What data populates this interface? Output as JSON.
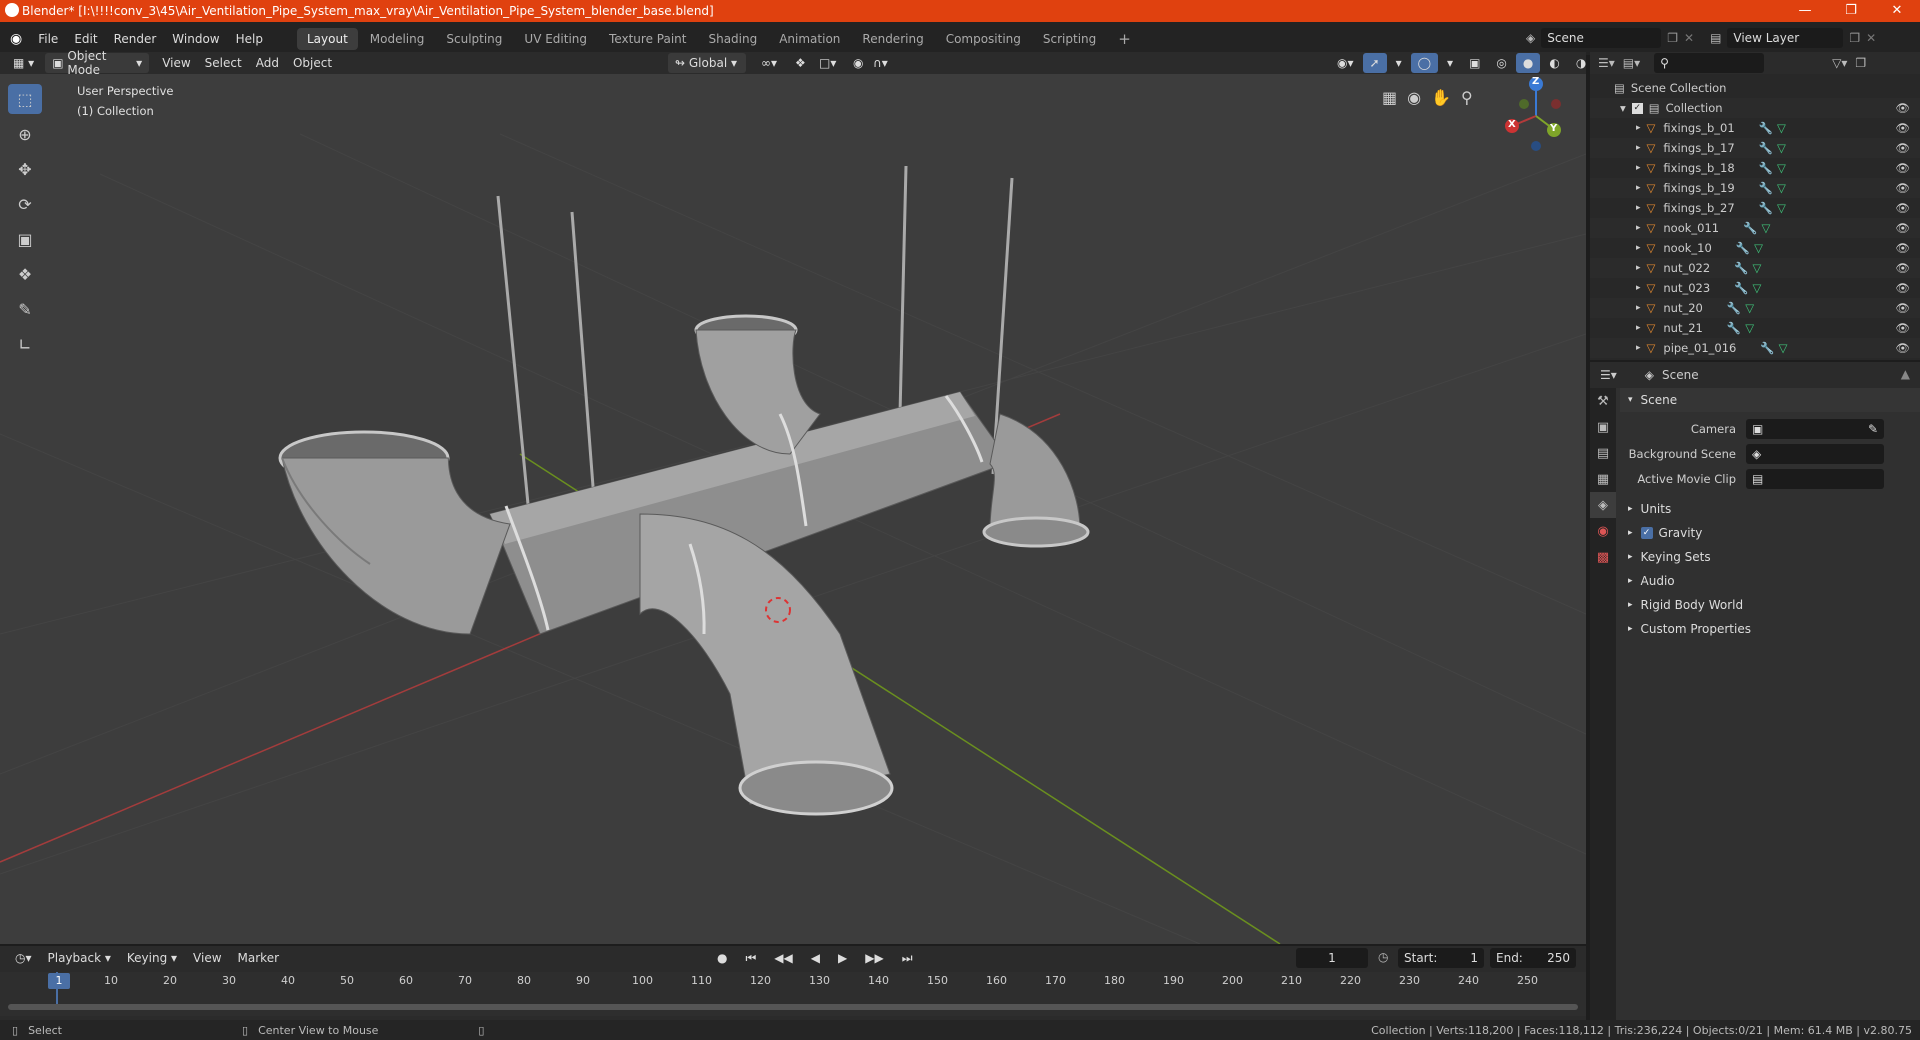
{
  "window": {
    "title": "Blender* [I:\\!!!!conv_3\\45\\Air_Ventilation_Pipe_System_max_vray\\Air_Ventilation_Pipe_System_blender_base.blend]"
  },
  "menu": {
    "items": [
      "File",
      "Edit",
      "Render",
      "Window",
      "Help"
    ],
    "workspaces": [
      "Layout",
      "Modeling",
      "Sculpting",
      "UV Editing",
      "Texture Paint",
      "Shading",
      "Animation",
      "Rendering",
      "Compositing",
      "Scripting"
    ],
    "active_workspace": "Layout",
    "scene": "Scene",
    "view_layer": "View Layer"
  },
  "viewport_header": {
    "mode": "Object Mode",
    "menus": [
      "View",
      "Select",
      "Add",
      "Object"
    ],
    "orientation": "Global"
  },
  "viewport": {
    "perspective": "User Perspective",
    "collection": "(1) Collection",
    "gizmo": {
      "x": "X",
      "y": "Y",
      "z": "Z"
    }
  },
  "outliner": {
    "root": "Scene Collection",
    "collection": "Collection",
    "items": [
      "fixings_b_01",
      "fixings_b_17",
      "fixings_b_18",
      "fixings_b_19",
      "fixings_b_27",
      "nook_011",
      "nook_10",
      "nut_022",
      "nut_023",
      "nut_20",
      "nut_21",
      "pipe_01_016"
    ]
  },
  "properties": {
    "context": "Scene",
    "section": "Scene",
    "fields": [
      {
        "label": "Camera",
        "value": ""
      },
      {
        "label": "Background Scene",
        "value": ""
      },
      {
        "label": "Active Movie Clip",
        "value": ""
      }
    ],
    "panels": [
      "Units",
      "Gravity",
      "Keying Sets",
      "Audio",
      "Rigid Body World",
      "Custom Properties"
    ],
    "gravity_checked": true
  },
  "timeline": {
    "menus": [
      "Playback",
      "Keying",
      "View",
      "Marker"
    ],
    "current_frame": "1",
    "start_label": "Start:",
    "start": "1",
    "end_label": "End:",
    "end": "250",
    "ticks": [
      "1",
      "10",
      "20",
      "30",
      "40",
      "50",
      "60",
      "70",
      "80",
      "90",
      "100",
      "110",
      "120",
      "130",
      "140",
      "150",
      "160",
      "170",
      "180",
      "190",
      "200",
      "210",
      "220",
      "230",
      "240",
      "250"
    ]
  },
  "status": {
    "left1": "Select",
    "left2": "Center View to Mouse",
    "right": "Collection | Verts:118,200 | Faces:118,112 | Tris:236,224 | Objects:0/21 | Mem: 61.4 MB | v2.80.75"
  },
  "colors": {
    "titlebar": "#e0410f",
    "accent": "#4a6fa5",
    "x_axis": "#b33a3a",
    "y_axis": "#7fa529",
    "z_axis": "#3a7ad5"
  }
}
